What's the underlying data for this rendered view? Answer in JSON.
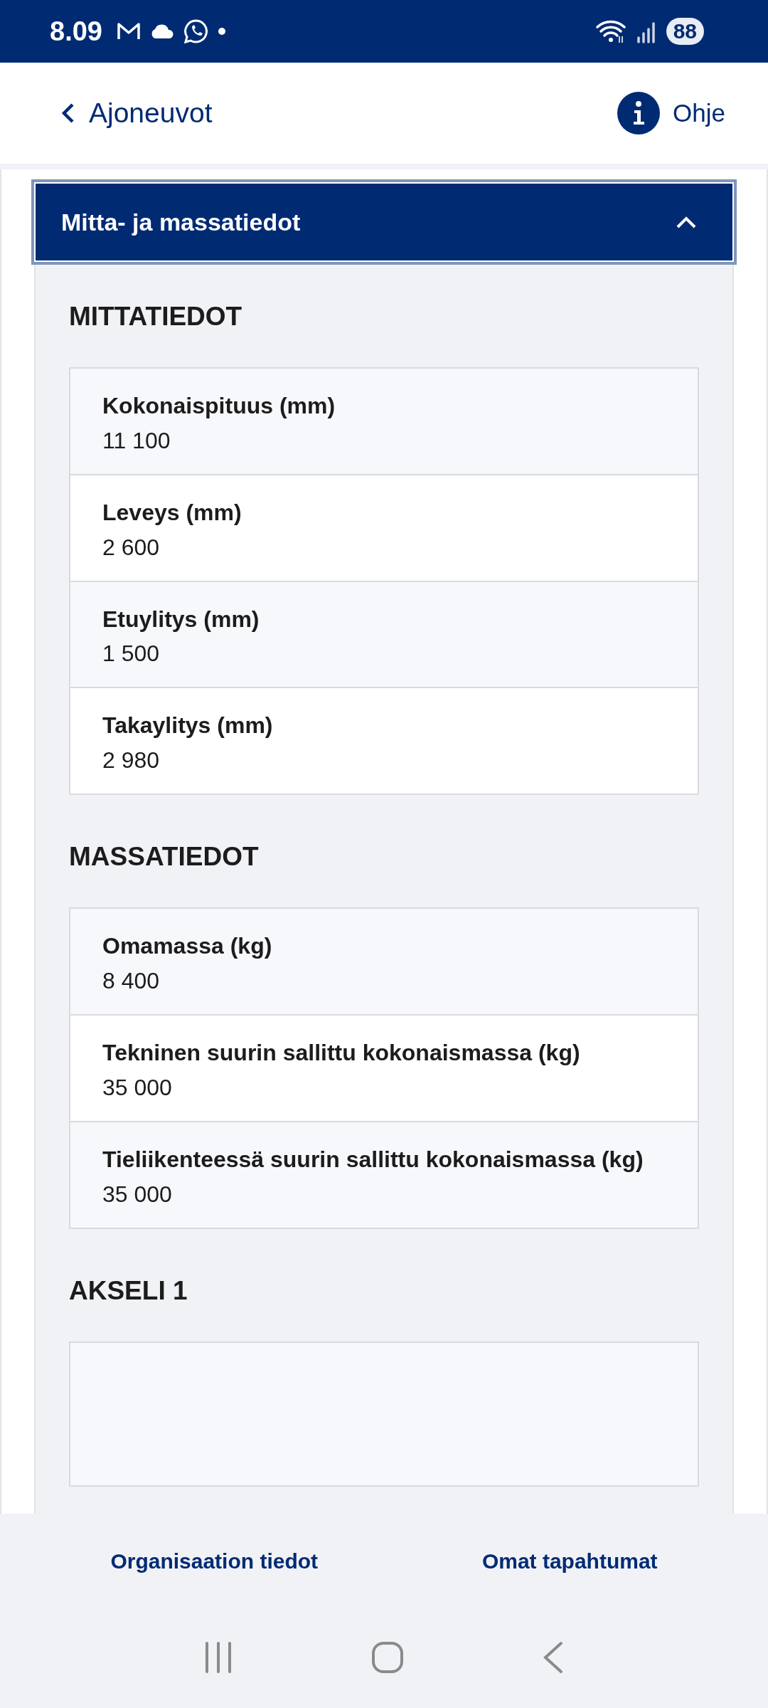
{
  "status_bar": {
    "time": "8.09",
    "battery": "88"
  },
  "header": {
    "back_label": "Ajoneuvot",
    "help_label": "Ohje"
  },
  "accordion": {
    "title": "Mitta- ja massatiedot",
    "expanded": true,
    "sections": [
      {
        "title": "MITTATIEDOT",
        "rows": [
          {
            "label": "Kokonaispituus (mm)",
            "value": "11 100"
          },
          {
            "label": "Leveys (mm)",
            "value": "2 600"
          },
          {
            "label": "Etuylitys (mm)",
            "value": "1 500"
          },
          {
            "label": "Takaylitys (mm)",
            "value": "2 980"
          }
        ]
      },
      {
        "title": "MASSATIEDOT",
        "rows": [
          {
            "label": "Omamassa (kg)",
            "value": "8 400"
          },
          {
            "label": "Tekninen suurin sallittu kokonaismassa (kg)",
            "value": "35 000"
          },
          {
            "label": "Tieliikenteessä suurin sallittu kokonaismassa (kg)",
            "value": "35 000"
          }
        ]
      },
      {
        "title": "AKSELI 1"
      }
    ]
  },
  "bottom_links": [
    "Organisaation tiedot",
    "Omat tapahtumat"
  ]
}
